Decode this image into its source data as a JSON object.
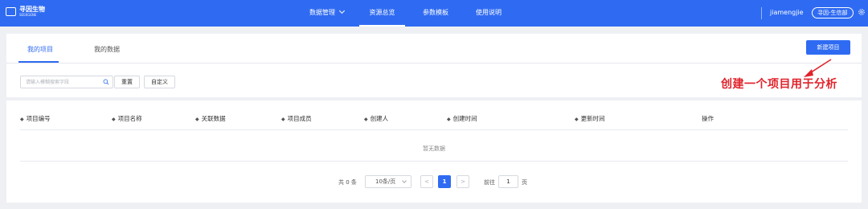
{
  "header": {
    "logo_name": "寻因生物",
    "logo_sub": "SEEKGENE",
    "nav": [
      {
        "label": "数据管理"
      },
      {
        "label": "资源总览"
      },
      {
        "label": "参数模板"
      },
      {
        "label": "使用说明"
      }
    ],
    "username": "jiamengjie",
    "org": "寻因-生信部",
    "settings_icon": "gear-icon"
  },
  "tabs": [
    {
      "label": "我的项目",
      "active": true
    },
    {
      "label": "我的数据",
      "active": false
    }
  ],
  "toolbar": {
    "new_project": "新建项目",
    "search_placeholder": "请输入模糊搜索字段",
    "reset": "重置",
    "customize": "自定义"
  },
  "annotation": {
    "text": "创建一个项目用于分析",
    "color": "#e0232b"
  },
  "table": {
    "columns": [
      "项目编号",
      "项目名称",
      "关联数据",
      "项目成员",
      "创建人",
      "创建时间",
      "更新时间",
      "操作"
    ],
    "empty_text": "暂无数据"
  },
  "pagination": {
    "total": "共 0 条",
    "page_size": "10条/页",
    "prev": "<",
    "current": "1",
    "next": ">",
    "goto_label": "前往",
    "goto_value": "1",
    "page_suffix": "页"
  },
  "colors": {
    "brand": "#2f6bf2",
    "background": "#eef0f4"
  }
}
